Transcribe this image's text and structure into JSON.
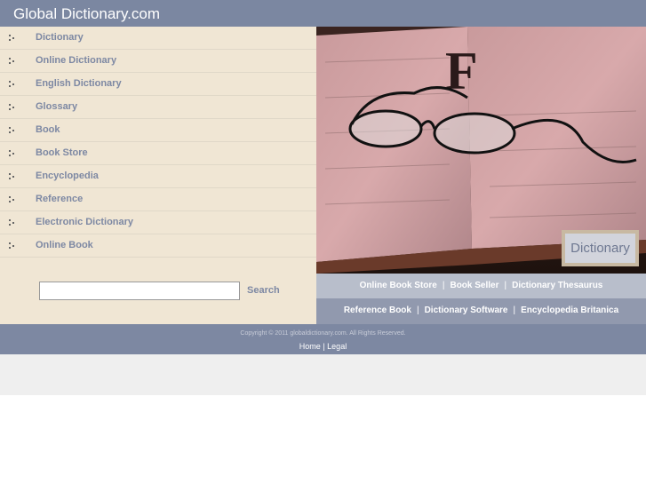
{
  "header": {
    "title": "Global Dictionary.com"
  },
  "menu": [
    "Dictionary",
    "Online Dictionary",
    "English Dictionary",
    "Glossary",
    "Book",
    "Book Store",
    "Encyclopedia",
    "Reference",
    "Electronic Dictionary",
    "Online Book"
  ],
  "search": {
    "value": "",
    "button": "Search"
  },
  "hero": {
    "badge": "Dictionary"
  },
  "links_row1": [
    "Online Book Store",
    "Book Seller",
    "Dictionary Thesaurus"
  ],
  "links_row2": [
    "Reference Book",
    "Dictionary Software",
    "Encyclopedia Britanica"
  ],
  "separator": "|",
  "footer": {
    "copyright": "Copyright © 2011 globaldictionary.com. All Rights Reserved.",
    "links": [
      "Home",
      "Legal"
    ]
  }
}
